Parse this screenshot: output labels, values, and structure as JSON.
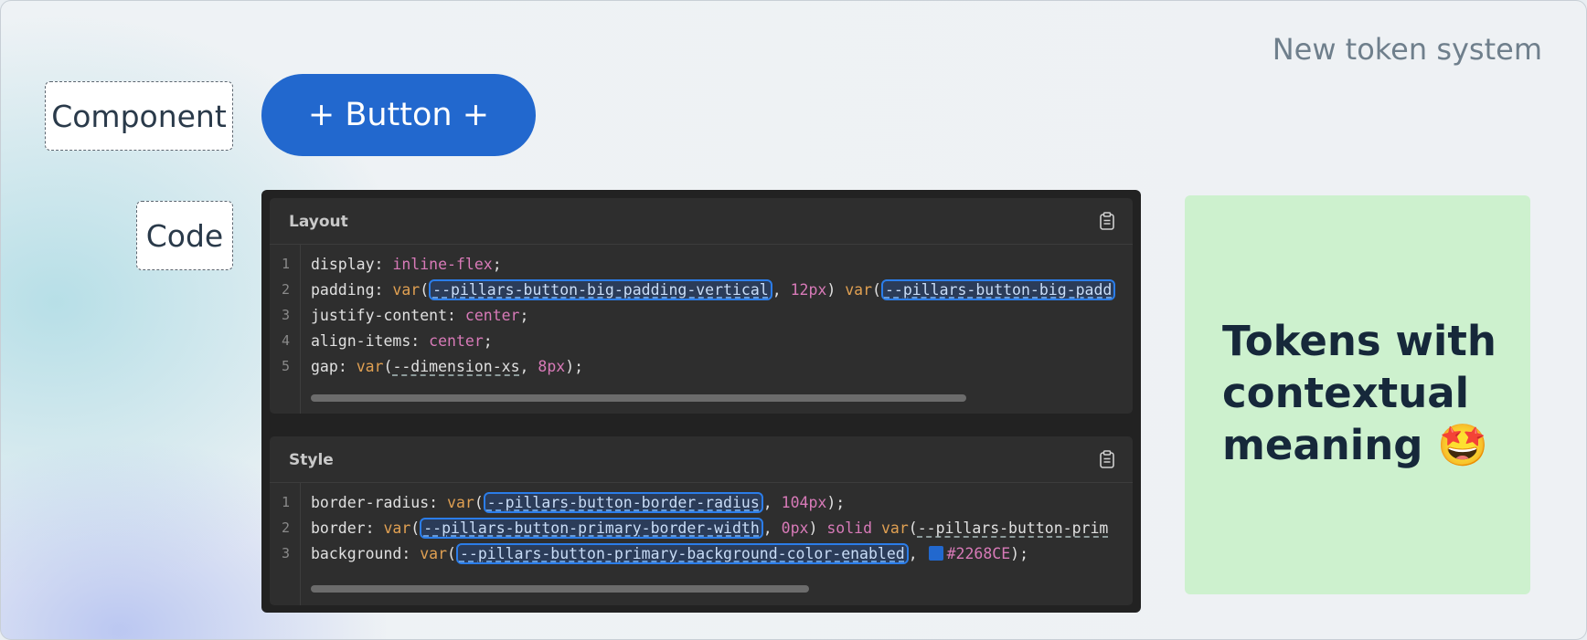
{
  "headline": "New token system",
  "labels": {
    "component": "Component",
    "code": "Code"
  },
  "button": {
    "label": "+ Button +",
    "color": "#2268CE"
  },
  "panels": {
    "layout": {
      "title": "Layout",
      "lines": [
        {
          "n": "1",
          "prop": "display",
          "value": "inline-flex"
        },
        {
          "n": "2",
          "prop": "padding",
          "token1": "--pillars-button-big-padding-vertical",
          "fallback1": "12px",
          "token2": "--pillars-button-big-padd"
        },
        {
          "n": "3",
          "prop": "justify-content",
          "value": "center"
        },
        {
          "n": "4",
          "prop": "align-items",
          "value": "center"
        },
        {
          "n": "5",
          "prop": "gap",
          "token": "--dimension-xs",
          "fallback": "8px"
        }
      ]
    },
    "style": {
      "title": "Style",
      "lines": [
        {
          "n": "1",
          "prop": "border-radius",
          "token": "--pillars-button-border-radius",
          "fallback": "104px"
        },
        {
          "n": "2",
          "prop": "border",
          "token": "--pillars-button-primary-border-width",
          "fallback": "0px",
          "mid": "solid",
          "token2": "--pillars-button-prim"
        },
        {
          "n": "3",
          "prop": "background",
          "token": "--pillars-button-primary-background-color-enabled",
          "fallback": "#2268CE"
        }
      ]
    }
  },
  "note": {
    "line1": "Tokens with",
    "line2": "contextual",
    "line3": "meaning",
    "emoji": "🤩"
  },
  "colors": {
    "accent": "#2268CE",
    "note_bg": "#CDF1CE",
    "code_bg": "#2E2E2E"
  }
}
